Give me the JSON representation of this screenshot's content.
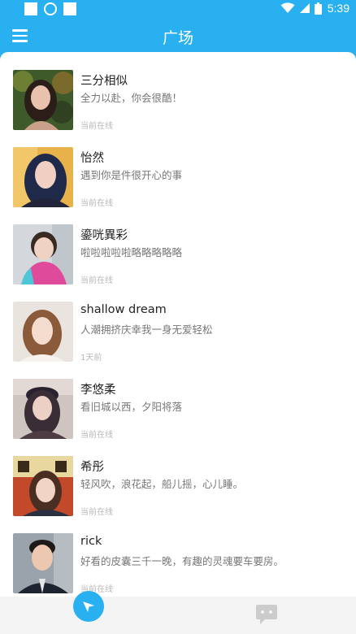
{
  "status_bar": {
    "time": "5:39",
    "left_icons": [
      "notification-square-icon",
      "app-circle-icon",
      "notification-square-icon"
    ],
    "right_icons": [
      "wifi-icon",
      "signal-icon",
      "battery-icon"
    ]
  },
  "header": {
    "title": "广场",
    "menu_icon": "hamburger-menu-icon"
  },
  "users": [
    {
      "name": "三分相似",
      "signature": "全力以赴，你会很酷！",
      "status": "当前在线"
    },
    {
      "name": "怡然",
      "signature": "遇到你是件很开心的事",
      "status": "当前在线"
    },
    {
      "name": "鎏咣異彩",
      "signature": "啦啦啦啦啦略略略略略",
      "status": "当前在线"
    },
    {
      "name": "shallow dream",
      "signature": "人潮拥挤庆幸我一身无爱轻松",
      "status": "1天前"
    },
    {
      "name": "李悠柔",
      "signature": "看旧城以西，夕阳将落",
      "status": "当前在线"
    },
    {
      "name": "希彤",
      "signature": "轻风吹，浪花起，船儿摇，心儿睡。",
      "status": "当前在线"
    },
    {
      "name": "rick",
      "signature": "好看的皮囊三千一晚，有趣的灵魂要车要房。",
      "status": "当前在线"
    }
  ],
  "bottom_nav": {
    "tabs": [
      "compass-icon",
      "chat-bubble-icon"
    ]
  },
  "colors": {
    "accent": "#29b0f0",
    "name_text": "#222222",
    "signature_text": "#777777",
    "status_text": "#b8b8b8",
    "bottom_bar": "#f4f4f4"
  }
}
